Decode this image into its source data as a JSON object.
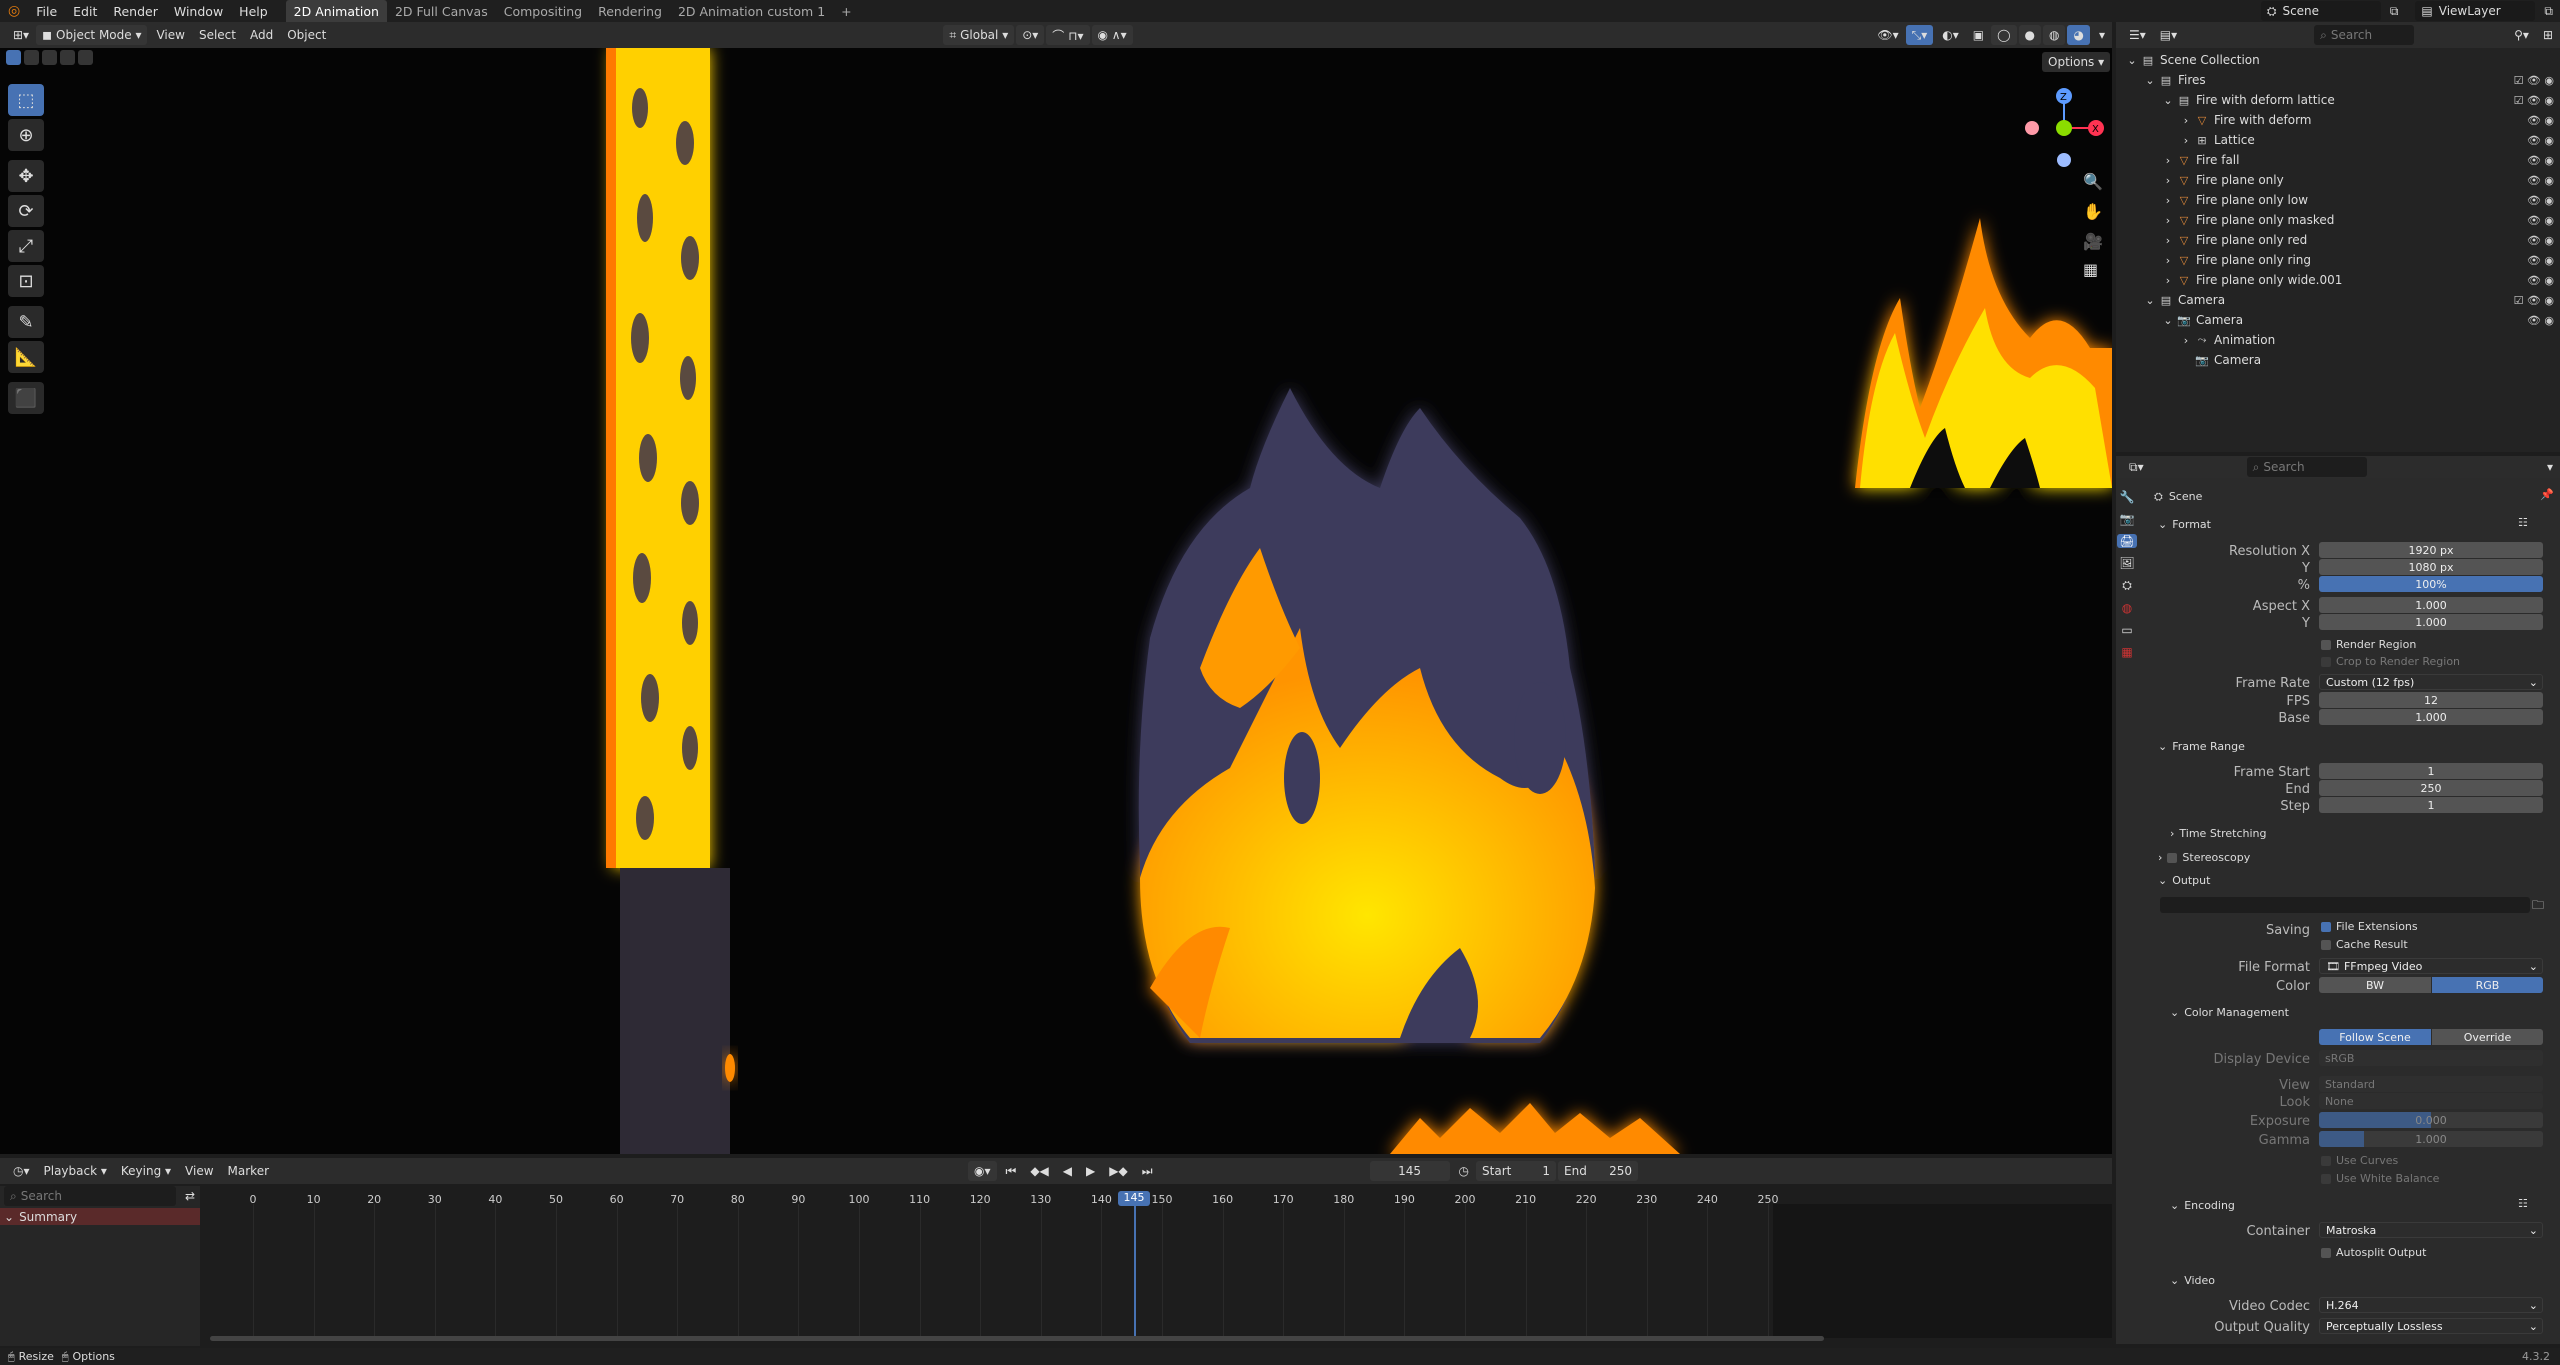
{
  "topbar": {
    "menus": [
      "File",
      "Edit",
      "Render",
      "Window",
      "Help"
    ],
    "workspaces": [
      "2D Animation",
      "2D Full Canvas",
      "Compositing",
      "Rendering",
      "2D Animation custom 1"
    ],
    "add": "+",
    "scene": "Scene",
    "viewlayer": "ViewLayer"
  },
  "viewport_header": {
    "mode": "Object Mode",
    "menus": [
      "View",
      "Select",
      "Add",
      "Object"
    ],
    "transform": "Global",
    "options": "Options"
  },
  "outliner": {
    "search_placeholder": "Search",
    "rows": [
      {
        "label": "Scene Collection",
        "indent": 0
      },
      {
        "label": "Fires",
        "indent": 1
      },
      {
        "label": "Fire with deform lattice",
        "indent": 2
      },
      {
        "label": "Fire with deform",
        "indent": 3
      },
      {
        "label": "Lattice",
        "indent": 3
      },
      {
        "label": "Fire fall",
        "indent": 2
      },
      {
        "label": "Fire plane only",
        "indent": 2
      },
      {
        "label": "Fire plane only low",
        "indent": 2
      },
      {
        "label": "Fire plane only masked",
        "indent": 2
      },
      {
        "label": "Fire plane only red",
        "indent": 2
      },
      {
        "label": "Fire plane only ring",
        "indent": 2
      },
      {
        "label": "Fire plane only wide.001",
        "indent": 2
      },
      {
        "label": "Camera",
        "indent": 1
      },
      {
        "label": "Camera",
        "indent": 2
      },
      {
        "label": "Animation",
        "indent": 3
      },
      {
        "label": "Camera",
        "indent": 3
      }
    ]
  },
  "properties": {
    "search_placeholder": "Search",
    "context": "Scene",
    "format": {
      "title": "Format",
      "res_x_label": "Resolution X",
      "res_x": "1920 px",
      "res_y_label": "Y",
      "res_y": "1080 px",
      "pct_label": "%",
      "pct": "100%",
      "aspect_x_label": "Aspect X",
      "aspect_x": "1.000",
      "aspect_y_label": "Y",
      "aspect_y": "1.000",
      "render_region": "Render Region",
      "crop": "Crop to Render Region",
      "frame_rate_label": "Frame Rate",
      "frame_rate": "Custom (12 fps)",
      "fps_label": "FPS",
      "fps": "12",
      "base_label": "Base",
      "base": "1.000"
    },
    "frame_range": {
      "title": "Frame Range",
      "start_label": "Frame Start",
      "start": "1",
      "end_label": "End",
      "end": "250",
      "step_label": "Step",
      "step": "1",
      "time_stretching": "Time Stretching"
    },
    "stereoscopy": "Stereoscopy",
    "output": {
      "title": "Output",
      "saving_label": "Saving",
      "file_ext": "File Extensions",
      "cache": "Cache Result",
      "file_format_label": "File Format",
      "file_format": "FFmpeg Video",
      "color_label": "Color",
      "bw": "BW",
      "rgb": "RGB"
    },
    "color_management": {
      "title": "Color Management",
      "follow": "Follow Scene",
      "override": "Override",
      "display_label": "Display Device",
      "display": "sRGB",
      "view_label": "View",
      "view": "Standard",
      "look_label": "Look",
      "look": "None",
      "exposure_label": "Exposure",
      "exposure": "0.000",
      "gamma_label": "Gamma",
      "gamma": "1.000",
      "curves": "Use Curves",
      "white": "Use White Balance"
    },
    "encoding": {
      "title": "Encoding",
      "container_label": "Container",
      "container": "Matroska",
      "autosplit": "Autosplit Output"
    },
    "video": {
      "title": "Video",
      "codec_label": "Video Codec",
      "codec": "H.264",
      "quality_label": "Output Quality",
      "quality": "Perceptually Lossless"
    }
  },
  "timeline": {
    "menus": [
      "Playback",
      "Keying",
      "View",
      "Marker"
    ],
    "current_frame": "145",
    "start_label": "Start",
    "start": "1",
    "end_label": "End",
    "end": "250",
    "search_placeholder": "Search",
    "summary": "Summary",
    "ticks": [
      "0",
      "10",
      "20",
      "30",
      "40",
      "50",
      "60",
      "70",
      "80",
      "90",
      "100",
      "110",
      "120",
      "130",
      "140",
      "150",
      "160",
      "170",
      "180",
      "190",
      "200",
      "210",
      "220",
      "230",
      "240",
      "250"
    ]
  },
  "statusbar": {
    "resize": "Resize",
    "options": "Options",
    "version": "4.3.2"
  },
  "colors": {
    "accent": "#4772b3",
    "fire": "#ffe000",
    "fire_edge": "#ff8a00",
    "smoke": "#3a3a55",
    "summary_bg": "#5a2a2a"
  }
}
